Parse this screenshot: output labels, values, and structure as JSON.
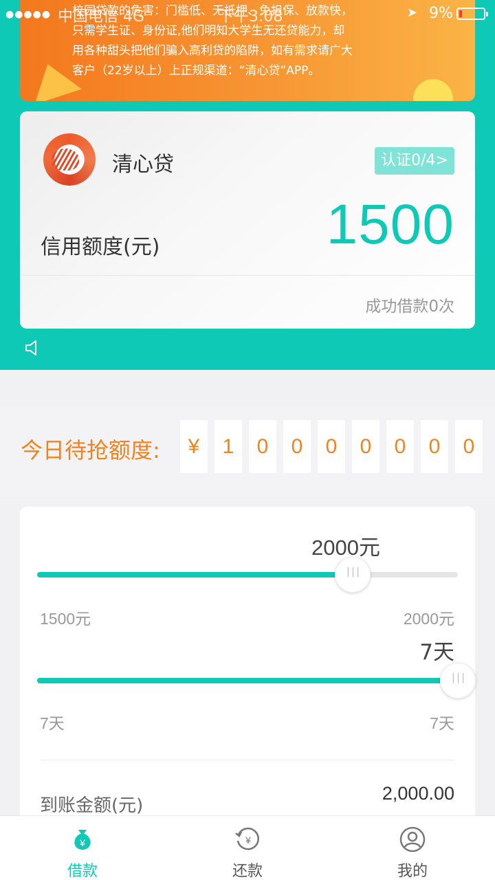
{
  "status_bar": {
    "signal_dots": "●●●●●",
    "carrier": "中国电信  4G",
    "time": "下午3:08",
    "battery": "9%"
  },
  "banner": {
    "lines": [
      "校园贷款的危害：门槛低、无抵押、免担保、放款快，",
      "只需学生证、身份证,他们明知大学生无还贷能力，却",
      "用各种甜头把他们骗入高利贷的陷阱，如有需求请广大",
      "客户（22岁以上）上正规渠道：“清心贷”APP。"
    ]
  },
  "card": {
    "app_name": "清心贷",
    "auth_badge": "认证0/4>",
    "credit_label": "信用额度(元)",
    "credit_amount": "1500",
    "success_text": "成功借款0次"
  },
  "rush": {
    "title": "今日待抢额度:",
    "digits": [
      "¥",
      "1",
      "0",
      "0",
      "0",
      "0",
      "0",
      "0",
      "0"
    ]
  },
  "amount_slider": {
    "value_label": "2000元",
    "min_label": "1500元",
    "max_label": "2000元",
    "fraction": 0.75
  },
  "days_slider": {
    "value_label": "7天",
    "min_label": "7天",
    "max_label": "7天",
    "fraction": 1.0
  },
  "arrival": {
    "label": "到账金额(元)",
    "value": "2,000.00"
  },
  "tabs": [
    {
      "label": "借款",
      "icon": "money-bag-icon",
      "active": true
    },
    {
      "label": "还款",
      "icon": "repay-icon",
      "active": false
    },
    {
      "label": "我的",
      "icon": "user-icon",
      "active": false
    }
  ],
  "colors": {
    "teal": "#0ec9b6",
    "orange": "#f1831e",
    "track_gray": "#e5e5e5"
  }
}
